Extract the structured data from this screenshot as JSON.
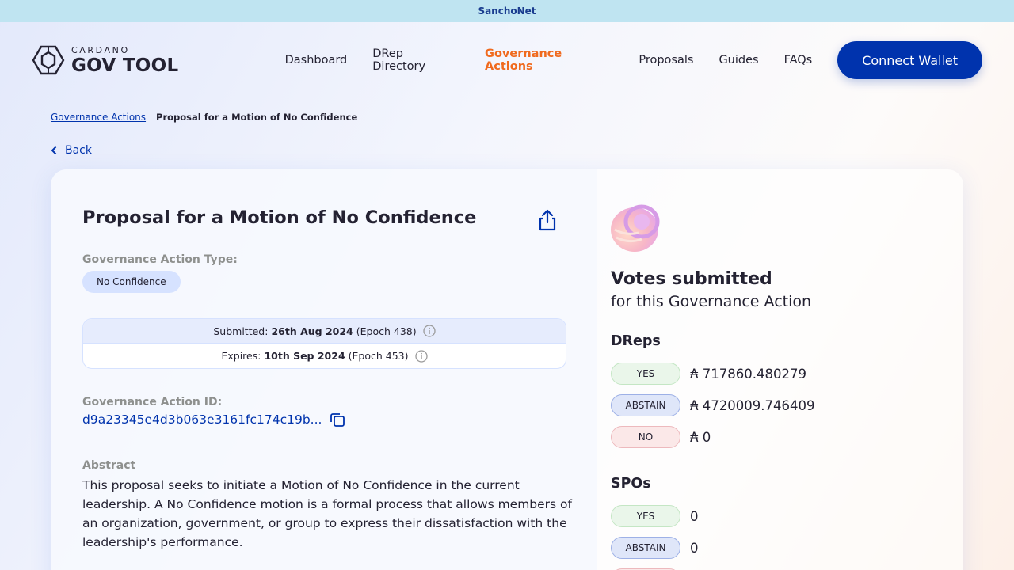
{
  "topbar": {
    "network": "SanchoNet"
  },
  "logo": {
    "small": "CARDANO",
    "big": "GOV TOOL"
  },
  "nav": {
    "items": [
      {
        "label": "Dashboard",
        "active": false
      },
      {
        "label": "DRep Directory",
        "active": false
      },
      {
        "label": "Governance Actions",
        "active": true
      },
      {
        "label": "Proposals",
        "active": false
      },
      {
        "label": "Guides",
        "active": false
      },
      {
        "label": "FAQs",
        "active": false
      }
    ],
    "connect_label": "Connect Wallet"
  },
  "breadcrumb": {
    "parent": "Governance Actions",
    "current": "Proposal for a Motion of No Confidence"
  },
  "back_label": "Back",
  "proposal": {
    "title": "Proposal for a Motion of No Confidence",
    "type_label": "Governance Action Type:",
    "type_value": "No Confidence",
    "submitted_prefix": "Submitted:",
    "submitted_date": "26th Aug 2024",
    "submitted_epoch": "(Epoch 438)",
    "expires_prefix": "Expires:",
    "expires_date": "10th Sep 2024",
    "expires_epoch": "(Epoch 453)",
    "id_label": "Governance Action ID:",
    "id_value": "d9a23345e4d3b063e3161fc174c19b...",
    "abstract_label": "Abstract",
    "abstract_text": "This proposal seeks to initiate a Motion of No Confidence in the current leadership. A No Confidence motion is a formal process that allows members of an organization, government, or group to express their dissatisfaction with the leadership's performance."
  },
  "votes": {
    "title": "Votes submitted",
    "subtitle": "for this Governance Action",
    "dreps": {
      "label": "DReps",
      "yes_label": "YES",
      "yes_value": "₳ 717860.480279",
      "abstain_label": "ABSTAIN",
      "abstain_value": "₳ 4720009.746409",
      "no_label": "NO",
      "no_value": "₳ 0"
    },
    "spos": {
      "label": "SPOs",
      "yes_label": "YES",
      "yes_value": "0",
      "abstain_label": "ABSTAIN",
      "abstain_value": "0"
    }
  },
  "colors": {
    "primary": "#0033ad",
    "active_nav": "#f06a1e",
    "topbar": "#bfe4f1"
  }
}
